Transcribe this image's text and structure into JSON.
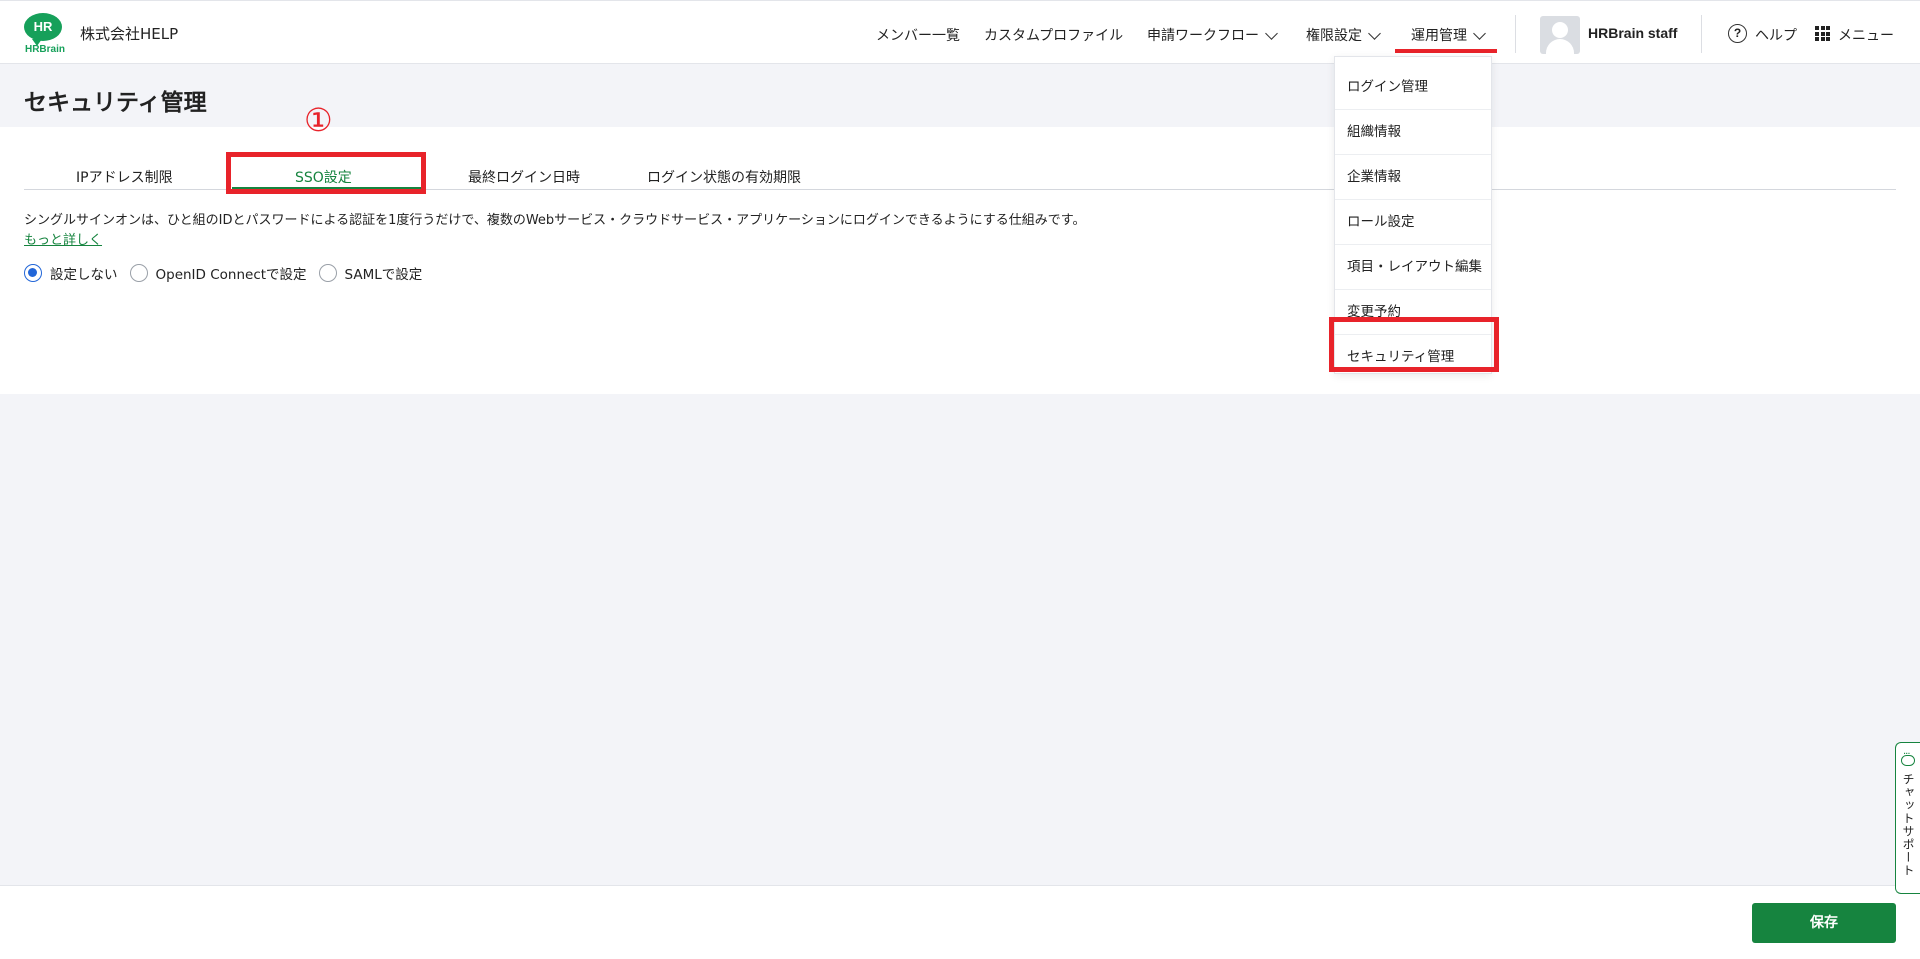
{
  "header": {
    "logo_text": "HR",
    "logo_sub": "HRBrain",
    "company": "株式会社HELP",
    "nav": [
      {
        "label": "メンバー一覧"
      },
      {
        "label": "カスタムプロファイル"
      },
      {
        "label": "申請ワークフロー"
      },
      {
        "label": "権限設定"
      },
      {
        "label": "運用管理"
      }
    ],
    "username": "HRBrain staff",
    "help_icon_glyph": "?",
    "help_label": "ヘルプ",
    "menu_label": "メニュー"
  },
  "dropdown": {
    "items": [
      {
        "label": "ログイン管理"
      },
      {
        "label": "組織情報"
      },
      {
        "label": "企業情報"
      },
      {
        "label": "ロール設定"
      },
      {
        "label": "項目・レイアウト編集"
      },
      {
        "label": "変更予約"
      },
      {
        "label": "セキュリティ管理"
      }
    ]
  },
  "page": {
    "title": "セキュリティ管理",
    "annotation": "①",
    "tabs": [
      {
        "label": "IPアドレス制限"
      },
      {
        "label": "SSO設定"
      },
      {
        "label": "最終ログイン日時"
      },
      {
        "label": "ログイン状態の有効期限"
      }
    ],
    "description": "シングルサインオンは、ひと組のIDとパスワードによる認証を1度行うだけで、複数のWebサービス・クラウドサービス・アプリケーションにログインできるようにする仕組みです。",
    "more_link": "もっと詳しく",
    "radios": [
      {
        "label": "設定しない",
        "checked": true
      },
      {
        "label": "OpenID Connectで設定",
        "checked": false
      },
      {
        "label": "SAMLで設定",
        "checked": false
      }
    ]
  },
  "footer": {
    "save_label": "保存",
    "chat_label": "チャットサポート"
  },
  "colors": {
    "brand_green": "#16a05a",
    "accent_green": "#16843f",
    "highlight_red": "#e8232a",
    "radio_blue": "#2266d8"
  }
}
